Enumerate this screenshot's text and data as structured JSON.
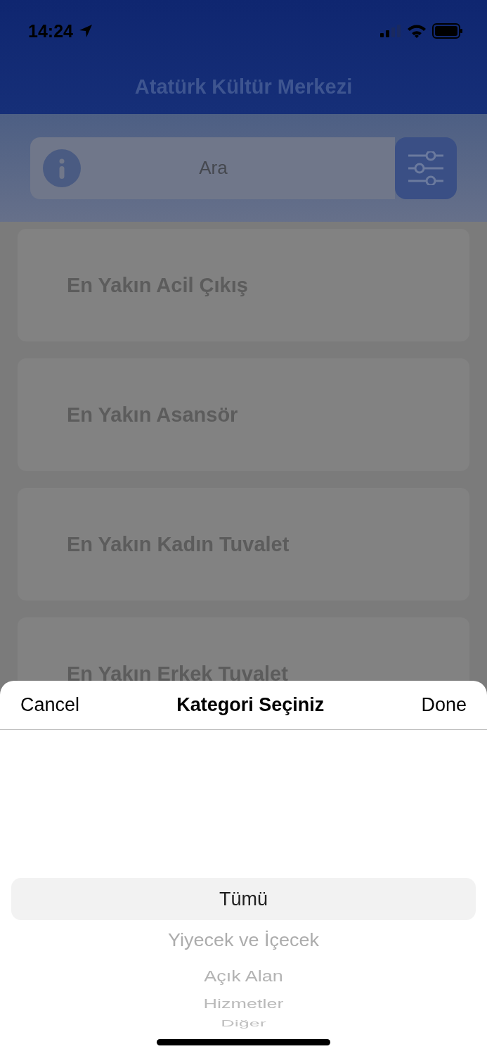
{
  "status_bar": {
    "time": "14:24"
  },
  "header": {
    "title": "Atatürk Kültür Merkezi"
  },
  "search": {
    "placeholder": "Ara"
  },
  "list": [
    {
      "label": "En Yakın Acil Çıkış"
    },
    {
      "label": "En Yakın Asansör"
    },
    {
      "label": "En Yakın Kadın Tuvalet"
    },
    {
      "label": "En Yakın Erkek Tuvalet"
    }
  ],
  "picker": {
    "cancel": "Cancel",
    "title": "Kategori Seçiniz",
    "done": "Done",
    "options": [
      {
        "label": "Tümü",
        "selected": true
      },
      {
        "label": "Yiyecek ve İçecek",
        "selected": false
      },
      {
        "label": "Açık Alan",
        "selected": false
      },
      {
        "label": "Hizmetler",
        "selected": false
      },
      {
        "label": "Diğer",
        "selected": false
      }
    ]
  }
}
